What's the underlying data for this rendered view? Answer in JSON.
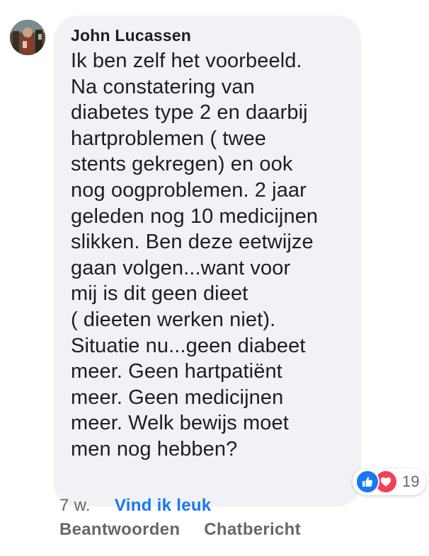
{
  "comment": {
    "author": "John Lucassen",
    "text": "Ik ben zelf het voorbeeld.\nNa constatering van\ndiabetes type 2 en daarbij\nhartproblemen ( twee\nstents gekregen) en ook\nnog oogproblemen. 2 jaar\ngeleden nog 10 medicijnen\nslikken. Ben deze eetwijze\ngaan volgen...want voor\nmij is dit geen dieet\n( dieeten werken niet).\nSituatie nu...geen diabeet\nmeer. Geen hartpatiënt\nmeer. Geen medicijnen\nmeer. Welk bewijs moet\nmen nog hebben?",
    "avatar_icon": "profile-photo",
    "reactions": {
      "icons": [
        "like-icon",
        "love-icon"
      ],
      "count": "19"
    },
    "timestamp": "7 w.",
    "like_label": "Vind ik leuk",
    "reply_label": "Beantwoorden",
    "chat_label": "Chatbericht"
  },
  "colors": {
    "bubble": "#f0f2f5",
    "link_blue": "#1877f2",
    "secondary": "#65676b",
    "love": "#f33e58"
  }
}
